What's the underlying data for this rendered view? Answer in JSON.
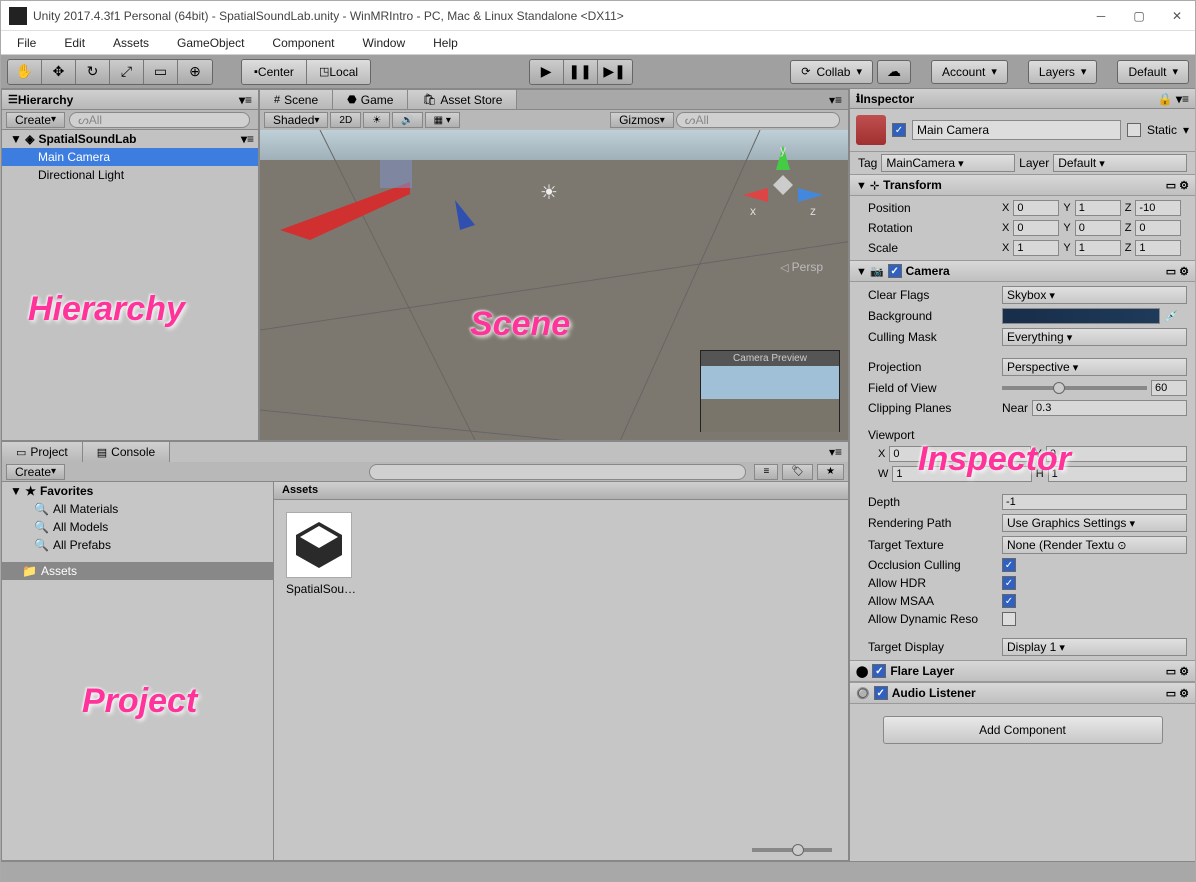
{
  "window": {
    "title": "Unity 2017.4.3f1 Personal (64bit) - SpatialSoundLab.unity - WinMRIntro - PC, Mac & Linux Standalone <DX11>"
  },
  "menu": [
    "File",
    "Edit",
    "Assets",
    "GameObject",
    "Component",
    "Window",
    "Help"
  ],
  "toolbar": {
    "center": "Center",
    "local": "Local",
    "collab": "Collab",
    "account": "Account",
    "layers": "Layers",
    "layout": "Default"
  },
  "hierarchy": {
    "title": "Hierarchy",
    "create": "Create",
    "search_placeholder": "All",
    "root": "SpatialSoundLab",
    "items": [
      "Main Camera",
      "Directional Light"
    ]
  },
  "scene_tabs": {
    "scene": "Scene",
    "game": "Game",
    "asset_store": "Asset Store"
  },
  "scene_toolbar": {
    "shaded": "Shaded",
    "twod": "2D",
    "gizmos": "Gizmos",
    "search": "All"
  },
  "scene": {
    "persp": "Persp",
    "axes": {
      "x": "x",
      "y": "y",
      "z": "z"
    },
    "cam_preview": "Camera Preview"
  },
  "project": {
    "title": "Project",
    "console": "Console",
    "create": "Create",
    "favorites": "Favorites",
    "fav_items": [
      "All Materials",
      "All Models",
      "All Prefabs"
    ],
    "assets_folder": "Assets",
    "assets_header": "Assets",
    "asset_name": "SpatialSou…"
  },
  "inspector": {
    "title": "Inspector",
    "obj_name": "Main Camera",
    "static": "Static",
    "tag_label": "Tag",
    "tag_value": "MainCamera",
    "layer_label": "Layer",
    "layer_value": "Default",
    "transform": {
      "title": "Transform",
      "position": {
        "label": "Position",
        "x": "0",
        "y": "1",
        "z": "-10"
      },
      "rotation": {
        "label": "Rotation",
        "x": "0",
        "y": "0",
        "z": "0"
      },
      "scale": {
        "label": "Scale",
        "x": "1",
        "y": "1",
        "z": "1"
      }
    },
    "camera": {
      "title": "Camera",
      "clear_flags": {
        "label": "Clear Flags",
        "value": "Skybox"
      },
      "background": "Background",
      "culling_mask": {
        "label": "Culling Mask",
        "value": "Everything"
      },
      "projection": {
        "label": "Projection",
        "value": "Perspective"
      },
      "fov": {
        "label": "Field of View",
        "value": "60"
      },
      "clipping": {
        "label": "Clipping Planes",
        "near_label": "Near",
        "near": "0.3"
      },
      "viewport": {
        "label": "Viewport",
        "x": "0",
        "y": "0",
        "w": "1",
        "h": "1"
      },
      "depth": {
        "label": "Depth",
        "value": "-1"
      },
      "rendering_path": {
        "label": "Rendering Path",
        "value": "Use Graphics Settings"
      },
      "target_texture": {
        "label": "Target Texture",
        "value": "None (Render Textu"
      },
      "occlusion": "Occlusion Culling",
      "hdr": "Allow HDR",
      "msaa": "Allow MSAA",
      "dynamic_reso": "Allow Dynamic Reso",
      "target_display": {
        "label": "Target Display",
        "value": "Display 1"
      }
    },
    "flare_layer": "Flare Layer",
    "audio_listener": "Audio Listener",
    "add_component": "Add Component"
  },
  "annotations": {
    "hierarchy": "Hierarchy",
    "scene": "Scene",
    "project": "Project",
    "inspector": "Inspector"
  }
}
